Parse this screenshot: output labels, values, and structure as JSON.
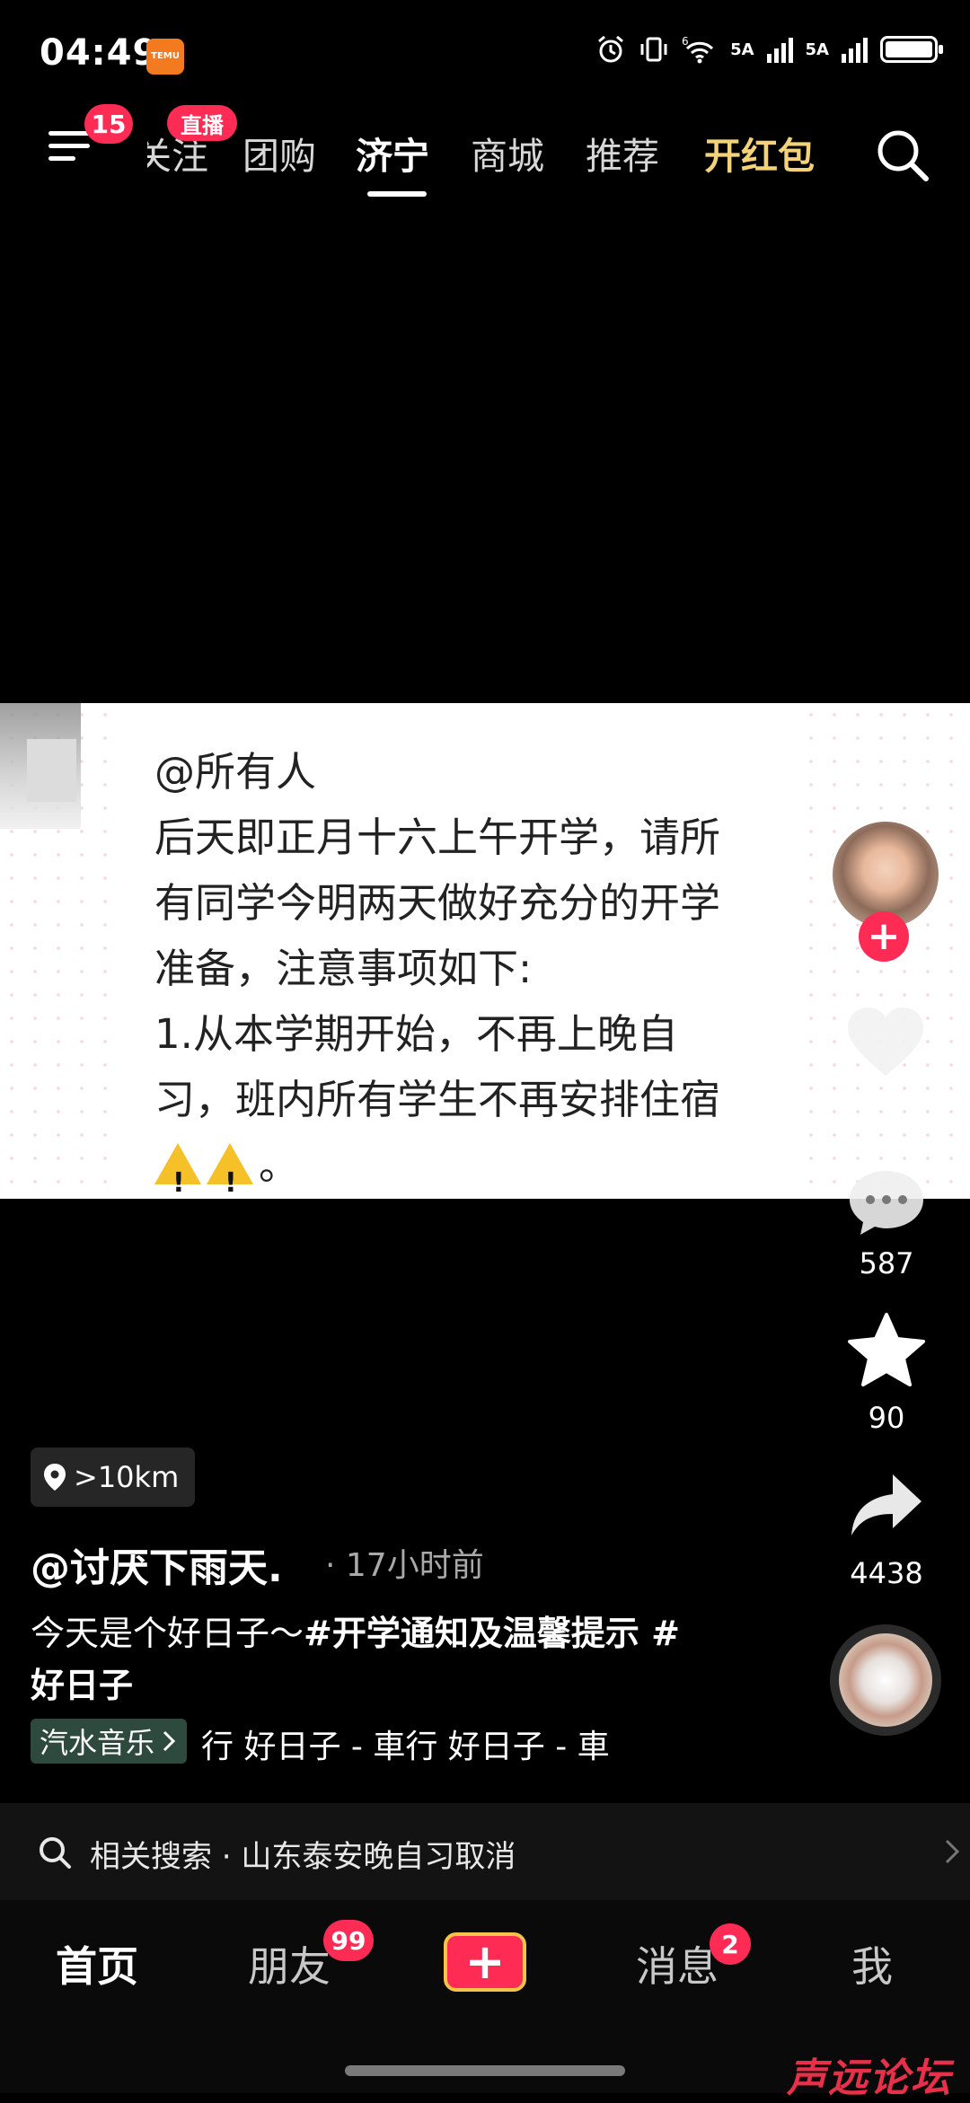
{
  "status": {
    "time": "04:49",
    "temu_label": "TEMU",
    "net1": "5A",
    "net2": "5A",
    "wifi_label": "6"
  },
  "nav": {
    "menu_badge": "15",
    "live_badge": "直播",
    "tabs": [
      "关注",
      "团购",
      "济宁",
      "商城",
      "推荐",
      "开红包"
    ],
    "active_tab": "济宁"
  },
  "post": {
    "note_lines": [
      "@所有人",
      "后天即正月十六上午开学，请所",
      "有同学今明两天做好充分的开学",
      "准备，注意事项如下:",
      "1.从本学期开始，不再上晚自",
      "习，班内所有学生不再安排住宿"
    ],
    "note_last_suffix": "。",
    "comments": "587",
    "favorites": "90",
    "shares": "4438",
    "location": ">10km",
    "author": "@讨厌下雨天.",
    "time_ago": "· 17小时前",
    "caption_plain": "今天是个好日子～",
    "caption_tag1": "#开学通知及温馨提示 #",
    "caption_tag2": "好日子",
    "music_tag": "汽水音乐",
    "music_title": "行  好日子 - 車行  好日子 - 車"
  },
  "related": {
    "label": "相关搜索 · 山东泰安晚自习取消"
  },
  "bottom_nav": {
    "home": "首页",
    "friends": "朋友",
    "friends_badge": "99",
    "create": "+",
    "messages": "消息",
    "messages_badge": "2",
    "me": "我"
  },
  "watermark": "声远论坛",
  "colors": {
    "accent": "#fe2c55",
    "gold_tab": "#f4d27a",
    "background": "#000000"
  }
}
